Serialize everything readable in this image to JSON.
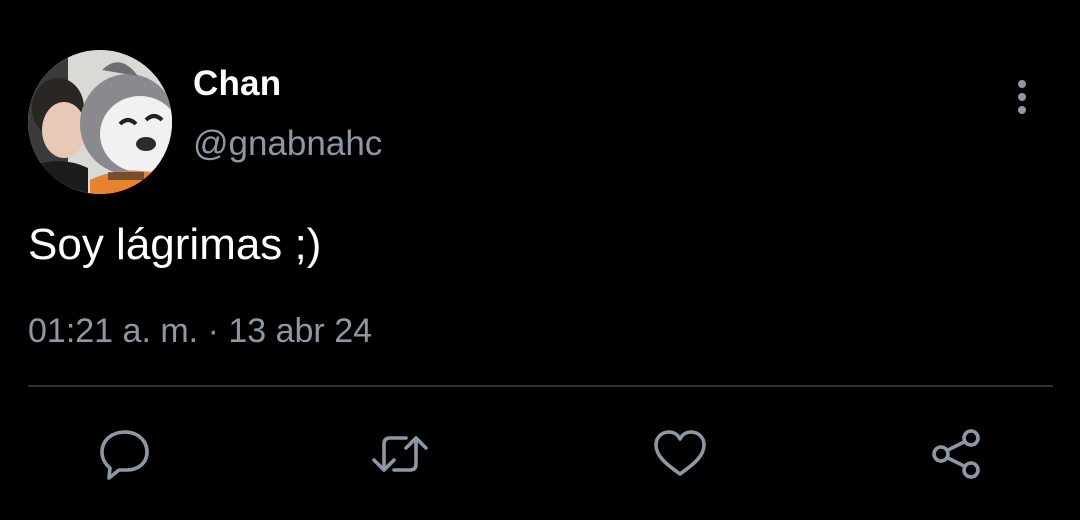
{
  "tweet": {
    "author": {
      "display_name": "Chan",
      "handle": "@gnabnahc",
      "avatar_icon": "profile-photo-with-mascot"
    },
    "text": "Soy lágrimas ;)",
    "time": "01:21 a. m.",
    "separator": "·",
    "date": "13 abr 24"
  },
  "actions": {
    "more_icon": "vertical-ellipsis-icon",
    "reply_icon": "speech-bubble-icon",
    "retweet_icon": "retweet-arrows-icon",
    "like_icon": "heart-outline-icon",
    "share_icon": "share-nodes-icon"
  },
  "colors": {
    "background": "#000000",
    "primary_text": "#ffffff",
    "secondary_text": "#8b98a5",
    "divider": "#2f3336",
    "icon": "#8b98a5"
  }
}
